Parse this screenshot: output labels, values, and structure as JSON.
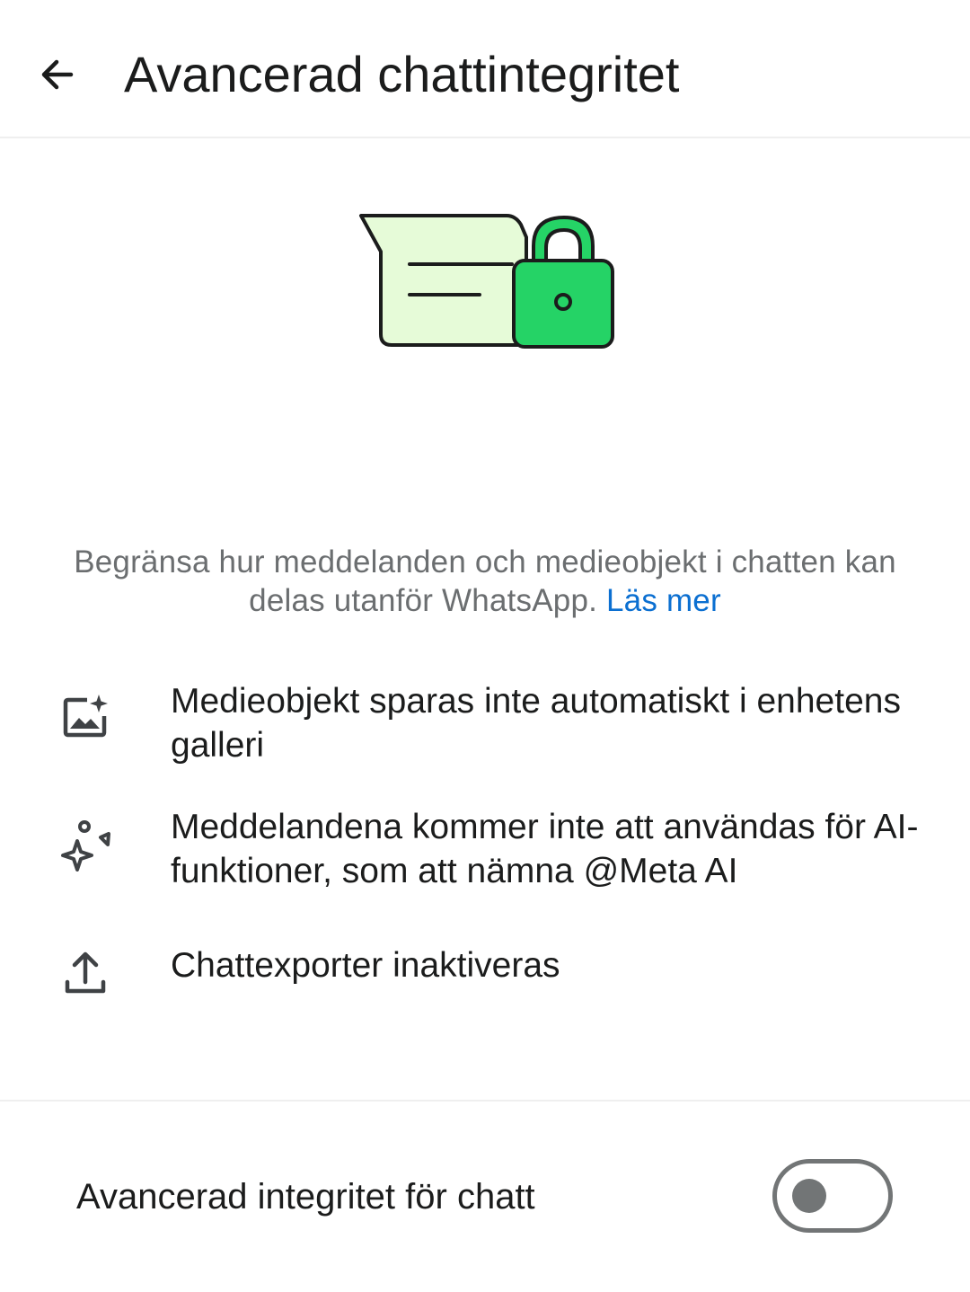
{
  "header": {
    "back_icon": "arrow-left-icon",
    "title": "Avancerad chattintegritet"
  },
  "illustration": {
    "icon": "locked-chat-illustration",
    "colors": {
      "bubble_fill": "#e6fbd8",
      "lock_fill": "#25d366",
      "outline": "#1b1c1c"
    }
  },
  "description": {
    "text": "Begränsa hur meddelanden och medieobjekt i chatten kan delas utanför WhatsApp.",
    "link_label": "Läs mer",
    "link_color": "#0b6fd1"
  },
  "features": [
    {
      "icon": "gallery-sparkle-icon",
      "text": "Medieobjekt sparas inte automatiskt i enhetens galleri"
    },
    {
      "icon": "ai-sparkle-icon",
      "text": "Meddelandena kommer inte att användas för AI-funktioner, som att nämna @Meta AI"
    },
    {
      "icon": "export-upload-icon",
      "text": "Chattexporter inaktiveras"
    }
  ],
  "setting": {
    "label": "Avancerad integritet för chatt",
    "enabled": false
  }
}
